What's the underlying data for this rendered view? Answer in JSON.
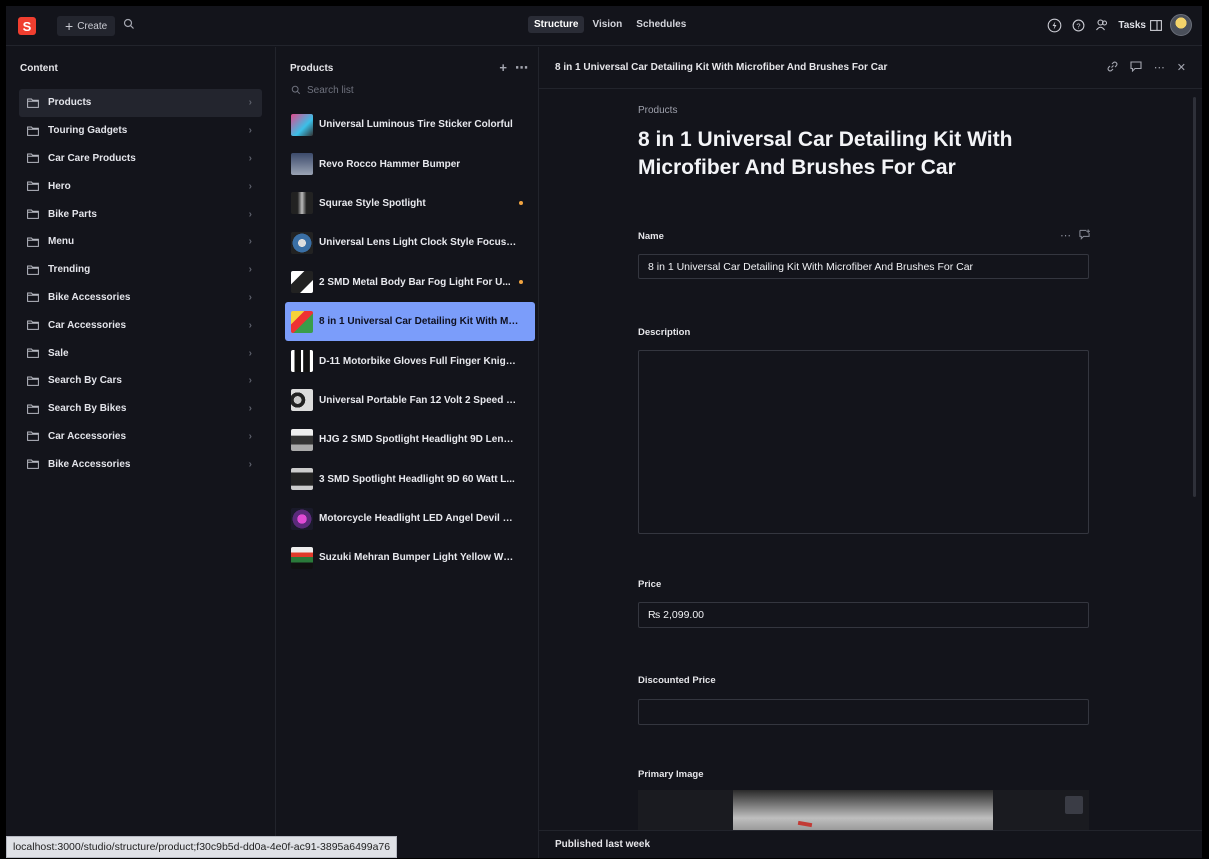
{
  "topbar": {
    "logo_letter": "S",
    "create_label": "Create",
    "tabs": [
      {
        "label": "Structure",
        "active": true
      },
      {
        "label": "Vision",
        "active": false
      },
      {
        "label": "Schedules",
        "active": false
      }
    ],
    "tasks_label": "Tasks"
  },
  "content_pane": {
    "title": "Content",
    "items": [
      {
        "label": "Products",
        "selected": true
      },
      {
        "label": "Touring Gadgets"
      },
      {
        "label": "Car Care Products"
      },
      {
        "label": "Hero"
      },
      {
        "label": "Bike Parts"
      },
      {
        "label": "Menu"
      },
      {
        "label": "Trending"
      },
      {
        "label": "Bike Accessories"
      },
      {
        "label": "Car Accessories"
      },
      {
        "label": "Sale"
      },
      {
        "label": "Search By Cars"
      },
      {
        "label": "Search By Bikes"
      },
      {
        "label": "Car Accessories"
      },
      {
        "label": "Bike Accessories"
      }
    ]
  },
  "products_pane": {
    "title": "Products",
    "search_placeholder": "Search list",
    "items": [
      {
        "label": "Universal Luminous Tire Sticker Colorful",
        "thumb": "linear-gradient(135deg,#e24a8d,#3ac0e8 60%,#333)"
      },
      {
        "label": "Revo Rocco Hammer Bumper",
        "thumb": "linear-gradient(180deg,#3b4a6b,#9aa3b4)"
      },
      {
        "label": "Squrae Style Spotlight",
        "thumb": "linear-gradient(90deg,#222 30%,#bbb 50%,#222 70%)",
        "changed": true
      },
      {
        "label": "Universal Lens Light Clock Style Focus Li...",
        "thumb": "radial-gradient(circle,#ddd 0 25%,#3a6fa5 26% 60%,#222 61%)"
      },
      {
        "label": "2 SMD Metal Body Bar Fog Light For U...",
        "thumb": "linear-gradient(135deg,#fff 0 30%,#222 31% 70%,#fff 71%)",
        "changed": true
      },
      {
        "label": "8 in 1 Universal Car Detailing Kit With Mi...",
        "thumb": "linear-gradient(135deg,#f5d23a 0 30%,#e33 31% 55%,#3a9d4a 56%)",
        "selected": true
      },
      {
        "label": "D-11 Motorbike Gloves Full Finger Knight...",
        "thumb": "linear-gradient(90deg,#fff 0 15%,#111 16% 45%,#fff 46% 55%,#111 56% 85%,#fff 86%)"
      },
      {
        "label": "Universal Portable Fan 12 Volt 2 Speed C...",
        "thumb": "radial-gradient(circle at 30% 50%,#ccc 0 20%,#222 21% 40%,#ddd 41%)"
      },
      {
        "label": "HJG 2 SMD Spotlight Headlight 9D Lens ...",
        "thumb": "linear-gradient(180deg,#eee 0 30%,#333 31% 70%,#aaa 71%)"
      },
      {
        "label": "3 SMD Spotlight Headlight 9D 60 Watt L...",
        "thumb": "linear-gradient(180deg,#ccc 0 20%,#222 21% 80%,#ccc 81%)"
      },
      {
        "label": "Motorcycle Headlight LED Angel Devil Ey...",
        "thumb": "radial-gradient(circle,#e04bd6 0 30%,#5a2a7a 31% 60%,#1a1a2a 61%)"
      },
      {
        "label": "Suzuki Mehran Bumper Light Yellow Whi...",
        "thumb": "linear-gradient(180deg,#eee 0 25%,#e03a2a 26% 45%,#2a7a3a 46% 70%,#111 71%)"
      }
    ]
  },
  "document": {
    "header_title": "8 in 1 Universal Car Detailing Kit With Microfiber And Brushes For Car",
    "breadcrumb": "Products",
    "title": "8 in 1 Universal Car Detailing Kit With Microfiber And Brushes For Car",
    "fields": {
      "name_label": "Name",
      "name_value": "8 in 1 Universal Car Detailing Kit With Microfiber And Brushes For Car",
      "description_label": "Description",
      "description_value": "",
      "price_label": "Price",
      "price_value": "₨ 2,099.00",
      "discounted_price_label": "Discounted Price",
      "discounted_price_value": "",
      "primary_image_label": "Primary Image"
    },
    "footer_status": "Published last week"
  },
  "statusbar": {
    "url": "localhost:3000/studio/structure/product;f30c9b5d-dd0a-4e0f-ac91-3895a6499a76"
  }
}
